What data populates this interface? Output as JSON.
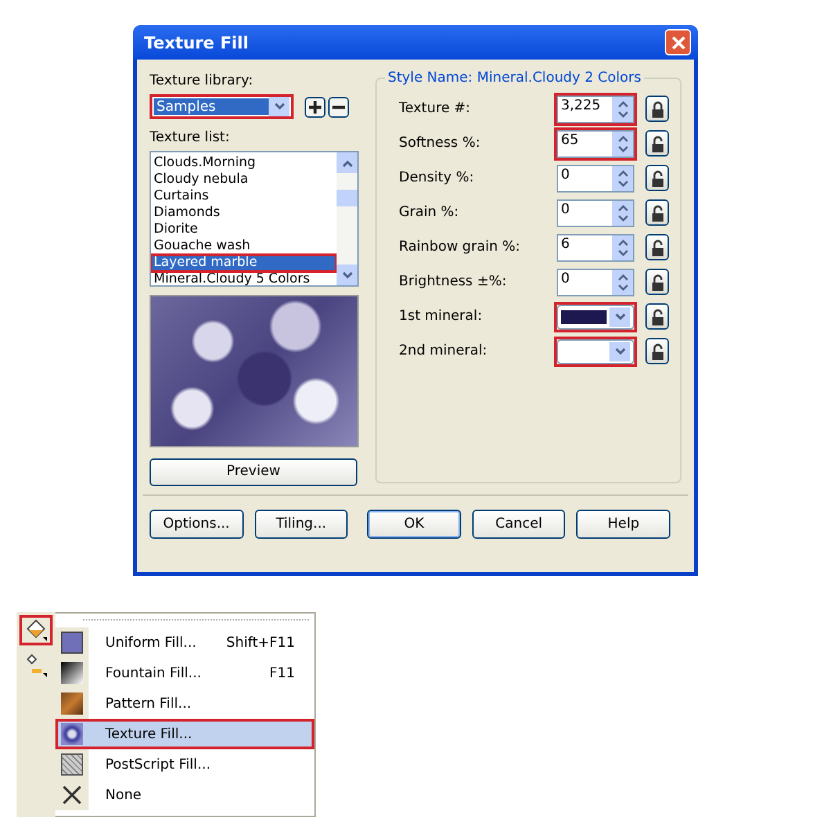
{
  "window": {
    "title": "Texture Fill"
  },
  "library": {
    "label": "Texture library:",
    "value": "Samples",
    "highlighted": true
  },
  "texture_list": {
    "label": "Texture list:",
    "items": [
      {
        "name": "Clouds.Morning",
        "selected": false
      },
      {
        "name": "Cloudy nebula",
        "selected": false
      },
      {
        "name": "Curtains",
        "selected": false
      },
      {
        "name": "Diamonds",
        "selected": false
      },
      {
        "name": "Diorite",
        "selected": false
      },
      {
        "name": "Gouache wash",
        "selected": false
      },
      {
        "name": "Layered marble",
        "selected": true
      },
      {
        "name": "Mineral.Cloudy 5 Colors",
        "selected": false
      }
    ]
  },
  "preview_button": "Preview",
  "style_name": "Style Name: Mineral.Cloudy 2 Colors",
  "params": [
    {
      "kind": "spin",
      "label": "Texture #:",
      "value": "3,225",
      "highlighted": true,
      "locked": true
    },
    {
      "kind": "spin",
      "label": "Softness %:",
      "value": "65",
      "highlighted": true,
      "locked": false
    },
    {
      "kind": "spin",
      "label": "Density %:",
      "value": "0",
      "highlighted": false,
      "locked": false
    },
    {
      "kind": "spin",
      "label": "Grain %:",
      "value": "0",
      "highlighted": false,
      "locked": false
    },
    {
      "kind": "spin",
      "label": "Rainbow grain %:",
      "value": "6",
      "highlighted": false,
      "locked": false
    },
    {
      "kind": "spin",
      "label": "Brightness ±%:",
      "value": "0",
      "highlighted": false,
      "locked": false
    },
    {
      "kind": "color",
      "label": "1st mineral:",
      "color": "#1e1850",
      "highlighted": true,
      "locked": false
    },
    {
      "kind": "color",
      "label": "2nd mineral:",
      "color": "#ffffff",
      "highlighted": true,
      "locked": false
    }
  ],
  "buttons": [
    {
      "label": "Options...",
      "default": false
    },
    {
      "label": "Tiling...",
      "default": false
    },
    {
      "label": "OK",
      "default": true
    },
    {
      "label": "Cancel",
      "default": false
    },
    {
      "label": "Help",
      "default": false
    }
  ],
  "toolbar": {
    "fill_tool_highlighted": true
  },
  "fill_menu": [
    {
      "kind": "uniform",
      "label": "Uniform Fill...",
      "shortcut": "Shift+F11",
      "highlighted": false
    },
    {
      "kind": "fountain",
      "label": "Fountain Fill...",
      "shortcut": "F11",
      "highlighted": false
    },
    {
      "kind": "pattern",
      "label": "Pattern Fill...",
      "highlighted": false
    },
    {
      "kind": "texture",
      "label": "Texture Fill...",
      "highlighted": true
    },
    {
      "kind": "postscript",
      "label": "PostScript Fill...",
      "highlighted": false
    },
    {
      "kind": "none",
      "label": "None",
      "highlighted": false
    }
  ]
}
